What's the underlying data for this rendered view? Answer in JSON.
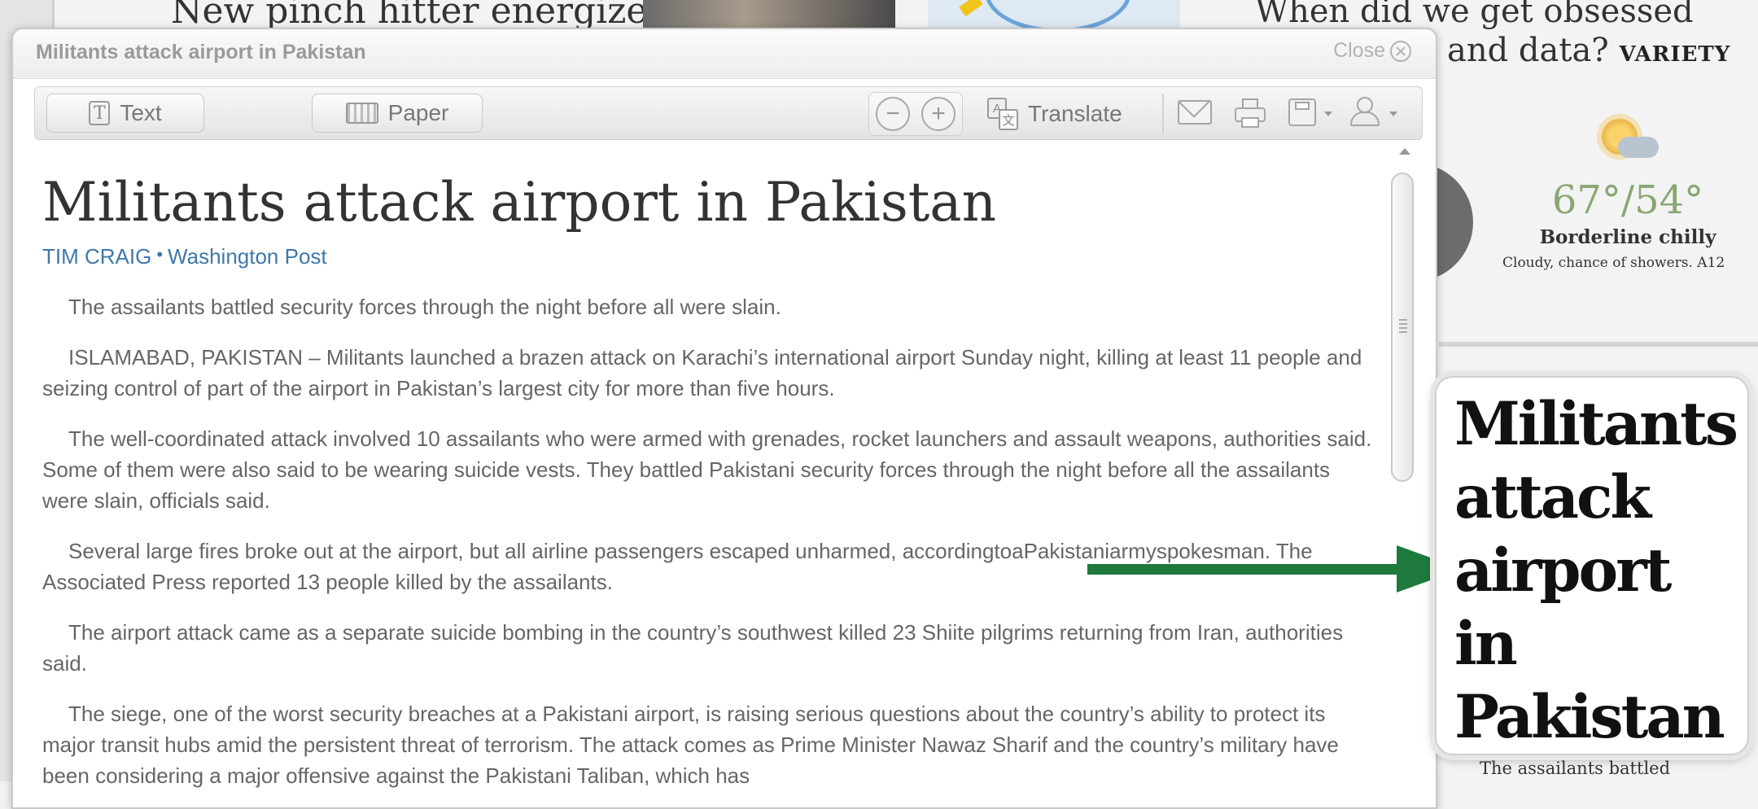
{
  "background_page": {
    "top_headline": "New pinch hitter energizes",
    "right_headline": "When did we get obsessed",
    "right_headline_line2": "and data?",
    "right_headline_source": "VARIETY",
    "weather": {
      "temperature": "67°/54°",
      "summary": "Borderline chilly",
      "detail": "Cloudy, chance of showers. A12"
    },
    "bottom_snippet": "The assailants battled"
  },
  "reader_window": {
    "title": "Militants attack airport in Pakistan",
    "close_label": "Close",
    "toolbar": {
      "text_label": "Text",
      "paper_label": "Paper",
      "translate_label": "Translate",
      "zoom_out_glyph": "−",
      "zoom_in_glyph": "+"
    },
    "article": {
      "headline": "Militants attack airport in Pakistan",
      "author": "TIM CRAIG",
      "publication": "Washington Post",
      "paragraphs": [
        "The assailants battled security forces through the night before all were slain.",
        "ISLAMABAD, PAKISTAN – Militants launched a brazen attack on Karachi’s international airport Sunday night, killing at least 11 people and seizing control of part of the airport in Pakistan’s largest city for more than five hours.",
        "The well-coordinated attack involved 10 assailants who were armed with grenades, rocket launchers and assault weapons, authorities said. Some of them were also said to be wearing suicide vests. They battled Pakistani security forces through the night before all the assailants were slain, officials said.",
        "Several large fires broke out at the airport, but all airline passengers escaped unharmed, accordingtoaPakistaniarmyspokesman. The Associated Press reported 13 people killed by the assailants.",
        "The airport attack came as a separate suicide bombing in the country’s southwest killed 23 Shiite pilgrims returning from Iran, authorities said.",
        "The siege, one of the worst security breaches at a Pakistani airport, is raising serious questions about the country’s ability to protect its major transit hubs amid the persistent threat of terrorism. The attack comes as Prime Minister Nawaz Sharif and the country’s military have been considering a major offensive against the Pakistani Taliban, which has"
      ]
    }
  },
  "callout": {
    "headline": "Militants attack airport in Pakistan"
  },
  "colors": {
    "arrow": "#1d7a3c",
    "byline": "#3f78a8",
    "weather_temp": "#8aa672"
  },
  "icons": [
    "text-icon",
    "paper-icon",
    "zoom-out-icon",
    "zoom-in-icon",
    "translate-icon",
    "email-icon",
    "print-icon",
    "save-icon",
    "share-icon",
    "close-icon",
    "weather-icon",
    "arrow-icon"
  ]
}
